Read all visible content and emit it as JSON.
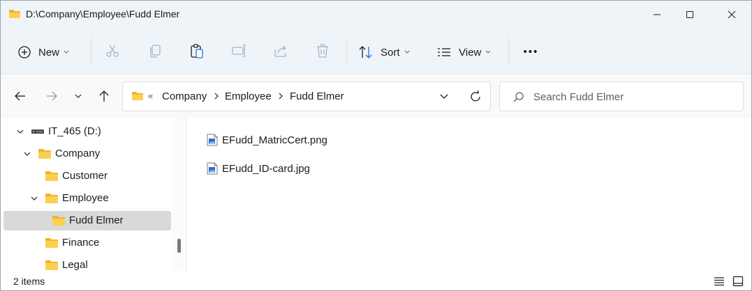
{
  "window": {
    "title": "D:\\Company\\Employee\\Fudd Elmer"
  },
  "toolbar": {
    "new_label": "New",
    "sort_label": "Sort",
    "view_label": "View",
    "more_label": "•••",
    "icons": [
      "plus-circle-icon",
      "cut-icon",
      "copy-icon",
      "paste-icon",
      "rename-icon",
      "share-icon",
      "delete-icon",
      "sort-icon",
      "view-icon",
      "more-icon"
    ]
  },
  "address": {
    "overflow": "«",
    "crumbs": [
      "Company",
      "Employee",
      "Fudd Elmer"
    ]
  },
  "search": {
    "placeholder": "Search Fudd Elmer"
  },
  "sidebar": {
    "items": [
      {
        "label": "IT_465 (D:)",
        "icon": "drive-icon",
        "expanded": true
      },
      {
        "label": "Company",
        "icon": "folder-icon",
        "expanded": true
      },
      {
        "label": "Customer",
        "icon": "folder-icon"
      },
      {
        "label": "Employee",
        "icon": "folder-icon",
        "expanded": true
      },
      {
        "label": "Fudd Elmer",
        "icon": "folder-icon",
        "selected": true
      },
      {
        "label": "Finance",
        "icon": "folder-icon"
      },
      {
        "label": "Legal",
        "icon": "folder-icon"
      }
    ]
  },
  "files": [
    {
      "name": "EFudd_MatricCert.png",
      "icon": "image-file-icon"
    },
    {
      "name": "EFudd_ID-card.jpg",
      "icon": "image-file-icon"
    }
  ],
  "status": {
    "item_count": "2 items"
  },
  "colors": {
    "folder": "#f8c23b",
    "chrome": "#eff4f9",
    "selected": "#d9d9d9",
    "accent": "#1a73d9"
  }
}
